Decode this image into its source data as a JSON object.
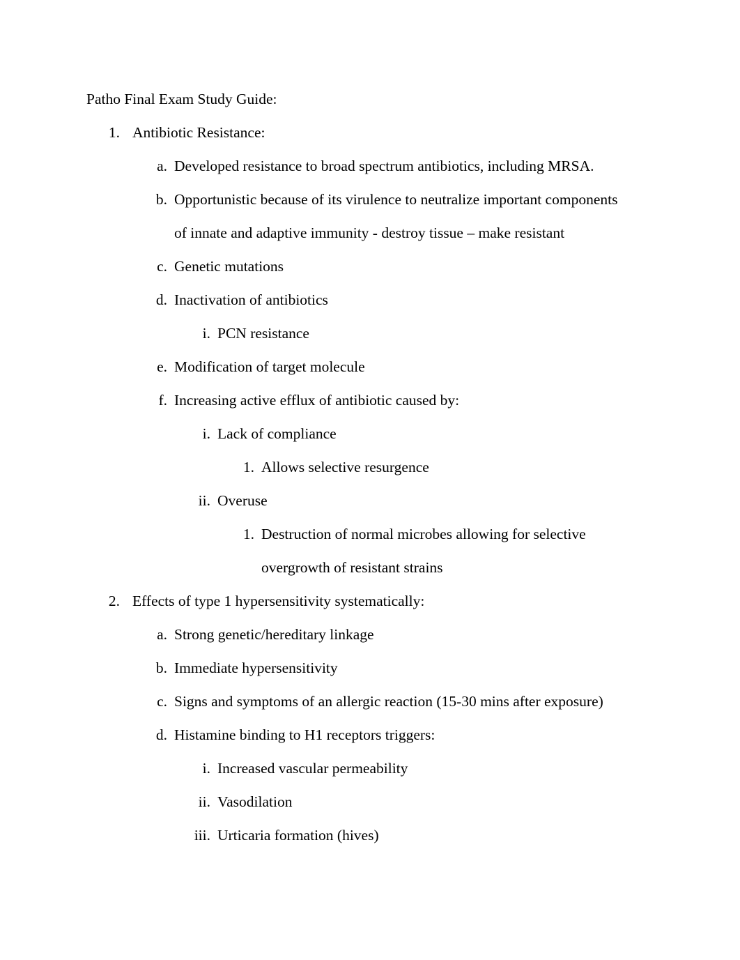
{
  "document": {
    "title": "Patho Final Exam Study Guide:",
    "outline": [
      {
        "marker": "1.",
        "level": 1,
        "text": "Antibiotic Resistance:",
        "children": [
          {
            "marker": "a.",
            "level": 2,
            "text": "Developed resistance to broad spectrum antibiotics, including MRSA.",
            "children": []
          },
          {
            "marker": "b.",
            "level": 2,
            "text": "Opportunistic because of its virulence to neutralize important components of innate and adaptive immunity - destroy tissue – make resistant",
            "children": []
          },
          {
            "marker": "c.",
            "level": 2,
            "text": "Genetic mutations",
            "children": []
          },
          {
            "marker": "d.",
            "level": 2,
            "text": "Inactivation of antibiotics",
            "children": [
              {
                "marker": "i.",
                "level": 3,
                "text": "PCN resistance",
                "children": []
              }
            ]
          },
          {
            "marker": "e.",
            "level": 2,
            "text": "Modification of target molecule",
            "children": []
          },
          {
            "marker": "f.",
            "level": 2,
            "text": "Increasing active efflux of antibiotic caused by:",
            "children": [
              {
                "marker": "i.",
                "level": 3,
                "text": "Lack of compliance",
                "children": [
                  {
                    "marker": "1.",
                    "level": 4,
                    "text": "Allows selective resurgence",
                    "children": []
                  }
                ]
              },
              {
                "marker": "ii.",
                "level": 3,
                "text": "Overuse",
                "children": [
                  {
                    "marker": "1.",
                    "level": 4,
                    "text": "Destruction of normal microbes allowing for selective overgrowth of resistant strains",
                    "children": []
                  }
                ]
              }
            ]
          }
        ]
      },
      {
        "marker": "2.",
        "level": 1,
        "text": "Effects of type 1 hypersensitivity systematically:",
        "children": [
          {
            "marker": "a.",
            "level": 2,
            "text": "Strong genetic/hereditary linkage",
            "children": []
          },
          {
            "marker": "b.",
            "level": 2,
            "text": "Immediate hypersensitivity",
            "children": []
          },
          {
            "marker": "c.",
            "level": 2,
            "text": "Signs and symptoms of an allergic reaction (15-30 mins after exposure)",
            "children": []
          },
          {
            "marker": "d.",
            "level": 2,
            "text": "Histamine binding to H1 receptors triggers:",
            "children": [
              {
                "marker": "i.",
                "level": 3,
                "text": "Increased vascular permeability",
                "children": []
              },
              {
                "marker": "ii.",
                "level": 3,
                "text": "Vasodilation",
                "children": []
              },
              {
                "marker": "iii.",
                "level": 3,
                "text": "Urticaria formation (hives)",
                "children": []
              }
            ]
          }
        ]
      }
    ]
  }
}
